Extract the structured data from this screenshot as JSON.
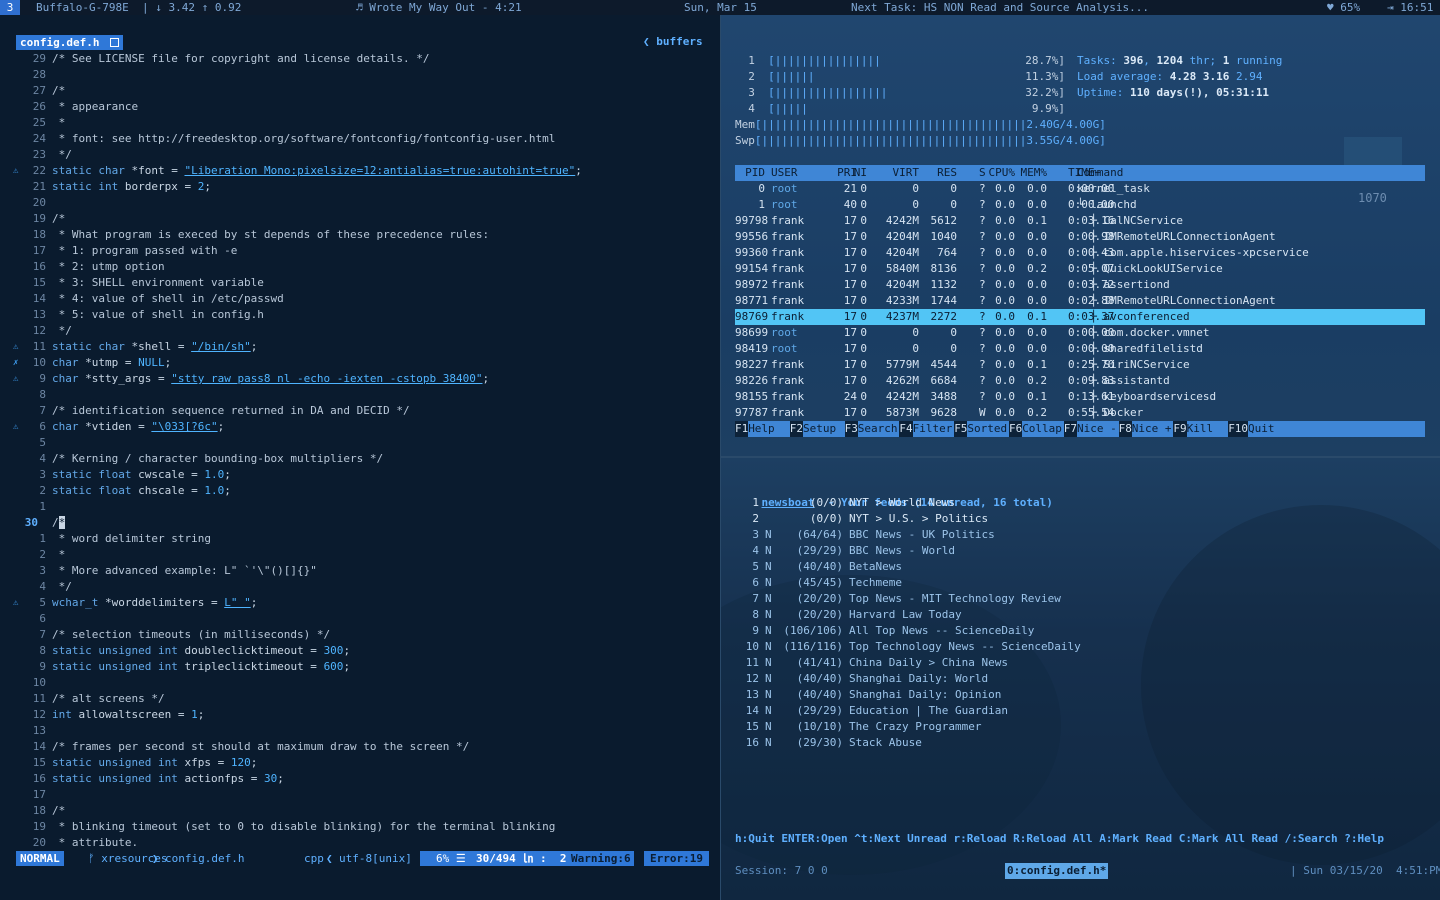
{
  "topbar": {
    "workspace": "3",
    "host": "Buffalo-G-798E",
    "net": "| ↓ 3.42 ↑ 0.92",
    "music": "♬ Wrote My Way Out - 4:21",
    "date": "Sun, Mar 15",
    "task": "Next Task: HS NON Read and Source Analysis...",
    "battery": "♥ 65%",
    "clock": "⇥ 16:51"
  },
  "editor": {
    "tab": "config.def.h",
    "tab_icon": "save-icon",
    "buffers_label": "buffers",
    "lines": [
      {
        "n": "29",
        "t": "/* See LICENSE file for copyright and license details. */"
      },
      {
        "n": "28",
        "t": ""
      },
      {
        "n": "27",
        "t": "/*"
      },
      {
        "n": "26",
        "t": " * appearance"
      },
      {
        "n": "25",
        "t": " *"
      },
      {
        "n": "24",
        "t": " * font: see http://freedesktop.org/software/fontconfig/fontconfig-user.html"
      },
      {
        "n": "23",
        "t": " */"
      },
      {
        "n": "22",
        "s": "⚠",
        "t": "static char *font = \"Liberation Mono:pixelsize=12:antialias=true:autohint=true\";"
      },
      {
        "n": "21",
        "t": "static int borderpx = 2;"
      },
      {
        "n": "20",
        "t": ""
      },
      {
        "n": "19",
        "t": "/*"
      },
      {
        "n": "18",
        "t": " * What program is execed by st depends of these precedence rules:"
      },
      {
        "n": "17",
        "t": " * 1: program passed with -e"
      },
      {
        "n": "16",
        "t": " * 2: utmp option"
      },
      {
        "n": "15",
        "t": " * 3: SHELL environment variable"
      },
      {
        "n": "14",
        "t": " * 4: value of shell in /etc/passwd"
      },
      {
        "n": "13",
        "t": " * 5: value of shell in config.h"
      },
      {
        "n": "12",
        "t": " */"
      },
      {
        "n": "11",
        "s": "⚠",
        "t": "static char *shell = \"/bin/sh\";"
      },
      {
        "n": "10",
        "s": "✗",
        "t": "char *utmp = NULL;"
      },
      {
        "n": "9",
        "s": "⚠",
        "t": "char *stty_args = \"stty raw pass8 nl -echo -iexten -cstopb 38400\";"
      },
      {
        "n": "8",
        "t": ""
      },
      {
        "n": "7",
        "t": "/* identification sequence returned in DA and DECID */"
      },
      {
        "n": "6",
        "s": "⚠",
        "t": "char *vtiden = \"\\033[?6c\";"
      },
      {
        "n": "5",
        "t": ""
      },
      {
        "n": "4",
        "t": "/* Kerning / character bounding-box multipliers */"
      },
      {
        "n": "3",
        "t": "static float cwscale = 1.0;"
      },
      {
        "n": "2",
        "t": "static float chscale = 1.0;"
      },
      {
        "n": "1",
        "t": ""
      },
      {
        "n": "30",
        "cur": true,
        "t": "/*"
      },
      {
        "n": "1",
        "t": " * word delimiter string"
      },
      {
        "n": "2",
        "t": " *"
      },
      {
        "n": "3",
        "t": " * More advanced example: L\" `'\\\"()[]{}\""
      },
      {
        "n": "4",
        "t": " */"
      },
      {
        "n": "5",
        "s": "⚠",
        "t": "wchar_t *worddelimiters = L\" \";"
      },
      {
        "n": "6",
        "t": ""
      },
      {
        "n": "7",
        "t": "/* selection timeouts (in milliseconds) */"
      },
      {
        "n": "8",
        "t": "static unsigned int doubleclicktimeout = 300;"
      },
      {
        "n": "9",
        "t": "static unsigned int tripleclicktimeout = 600;"
      },
      {
        "n": "10",
        "t": ""
      },
      {
        "n": "11",
        "t": "/* alt screens */"
      },
      {
        "n": "12",
        "t": "int allowaltscreen = 1;"
      },
      {
        "n": "13",
        "t": ""
      },
      {
        "n": "14",
        "t": "/* frames per second st should at maximum draw to the screen */"
      },
      {
        "n": "15",
        "t": "static unsigned int xfps = 120;"
      },
      {
        "n": "16",
        "t": "static unsigned int actionfps = 30;"
      },
      {
        "n": "17",
        "t": ""
      },
      {
        "n": "18",
        "t": "/*"
      },
      {
        "n": "19",
        "t": " * blinking timeout (set to 0 to disable blinking) for the terminal blinking"
      },
      {
        "n": "20",
        "t": " * attribute."
      }
    ],
    "status": {
      "mode": "NORMAL",
      "branch": "ᚠ xresources",
      "file": "config.def.h",
      "ft": "cpp",
      "enc": "utf-8[unix]",
      "pct": "6% ☰",
      "pos": "30/494 ㏑ :  2",
      "warn": "Warning:6",
      "err": "Error:19"
    }
  },
  "htop": {
    "cpus": [
      {
        "id": "1",
        "bar": "[||||||||||||||||",
        "pct": "28.7%]"
      },
      {
        "id": "2",
        "bar": "[||||||",
        "pct": "11.3%]"
      },
      {
        "id": "3",
        "bar": "[|||||||||||||||||",
        "pct": "32.2%]"
      },
      {
        "id": "4",
        "bar": "[|||||",
        "pct": "9.9%]"
      }
    ],
    "mem": {
      "label": "Mem",
      "bar": "[||||||||||||||||||||||||||||||||||||||||2.40G/4.00G]"
    },
    "swp": {
      "label": "Swp",
      "bar": "[||||||||||||||||||||||||||||||||||||||||3.55G/4.00G]"
    },
    "tasks": [
      "Tasks: ",
      "396",
      ", ",
      "1204",
      " thr; ",
      "1",
      " running"
    ],
    "load": [
      "Load average: ",
      "4.28",
      " ",
      "3.16",
      " 2.94"
    ],
    "uptime": [
      "Uptime: ",
      "110 days(!), 05:31:11"
    ],
    "headers": [
      "PID",
      "USER",
      "PRI",
      "NI",
      "VIRT",
      "RES",
      "S",
      "CPU%",
      "MEM%",
      "TIME+",
      "Command"
    ],
    "rows": [
      [
        "0",
        "root",
        "21",
        "0",
        "0",
        "0",
        "?",
        "0.0",
        "0.0",
        "0:00.00",
        "kernel_task"
      ],
      [
        "1",
        "root",
        "40",
        "0",
        "0",
        "0",
        "?",
        "0.0",
        "0.0",
        "0:00.00",
        "└ launchd"
      ],
      [
        "99798",
        "frank",
        "17",
        "0",
        "4242M",
        "5612",
        "?",
        "0.0",
        "0.1",
        "0:03.16",
        "  ├ CalNCService"
      ],
      [
        "99556",
        "frank",
        "17",
        "0",
        "4204M",
        "1040",
        "?",
        "0.0",
        "0.0",
        "0:00.98",
        "  ├ IMRemoteURLConnectionAgent"
      ],
      [
        "99360",
        "frank",
        "17",
        "0",
        "4204M",
        "764",
        "?",
        "0.0",
        "0.0",
        "0:00.43",
        "  ├ com.apple.hiservices-xpcservice"
      ],
      [
        "99154",
        "frank",
        "17",
        "0",
        "5840M",
        "8136",
        "?",
        "0.0",
        "0.2",
        "0:05.07",
        "  ├ QuickLookUIService"
      ],
      [
        "98972",
        "frank",
        "17",
        "0",
        "4204M",
        "1132",
        "?",
        "0.0",
        "0.0",
        "0:03.72",
        "  ├ assertiond"
      ],
      [
        "98771",
        "frank",
        "17",
        "0",
        "4233M",
        "1744",
        "?",
        "0.0",
        "0.0",
        "0:02.88",
        "  ├ IMRemoteURLConnectionAgent"
      ],
      [
        "98769",
        "frank",
        "17",
        "0",
        "4237M",
        "2272",
        "?",
        "0.0",
        "0.1",
        "0:03.37",
        "  ├ avconferenced"
      ],
      [
        "98699",
        "root",
        "17",
        "0",
        "0",
        "0",
        "?",
        "0.0",
        "0.0",
        "0:00.00",
        "  ├ com.docker.vmnet"
      ],
      [
        "98419",
        "root",
        "17",
        "0",
        "0",
        "0",
        "?",
        "0.0",
        "0.0",
        "0:00.00",
        "  ├ sharedfilelistd"
      ],
      [
        "98227",
        "frank",
        "17",
        "0",
        "5779M",
        "4544",
        "?",
        "0.0",
        "0.1",
        "0:25.70",
        "  ├ SiriNCService"
      ],
      [
        "98226",
        "frank",
        "17",
        "0",
        "4262M",
        "6684",
        "?",
        "0.0",
        "0.2",
        "0:09.83",
        "  ├ assistantd"
      ],
      [
        "98155",
        "frank",
        "24",
        "0",
        "4242M",
        "3488",
        "?",
        "0.0",
        "0.1",
        "0:13.61",
        "  ├ keyboardservicesd"
      ],
      [
        "97787",
        "frank",
        "17",
        "0",
        "5873M",
        "9628",
        "W",
        "0.0",
        "0.2",
        "0:55.54",
        "  ├ Docker"
      ]
    ],
    "selected_row": 8,
    "fkeys": [
      {
        "k": "F1",
        "l": "Help"
      },
      {
        "k": "F2",
        "l": "Setup"
      },
      {
        "k": "F3",
        "l": "Search"
      },
      {
        "k": "F4",
        "l": "Filter"
      },
      {
        "k": "F5",
        "l": "Sorted"
      },
      {
        "k": "F6",
        "l": "Collap"
      },
      {
        "k": "F7",
        "l": "Nice -"
      },
      {
        "k": "F8",
        "l": "Nice +"
      },
      {
        "k": "F9",
        "l": "Kill"
      },
      {
        "k": "F10",
        "l": "Quit"
      }
    ],
    "bg_number": "1070"
  },
  "newsboat": {
    "title": "newsboat",
    "subtitle": "- Your feeds (14 unread, 16 total)",
    "feeds": [
      {
        "i": "1",
        "f": "",
        "c": "(0/0)",
        "t": "NYT > World News"
      },
      {
        "i": "2",
        "f": "",
        "c": "(0/0)",
        "t": "NYT > U.S. > Politics"
      },
      {
        "i": "3",
        "f": "N",
        "c": "(64/64)",
        "t": "BBC News - UK Politics"
      },
      {
        "i": "4",
        "f": "N",
        "c": "(29/29)",
        "t": "BBC News - World"
      },
      {
        "i": "5",
        "f": "N",
        "c": "(40/40)",
        "t": "BetaNews"
      },
      {
        "i": "6",
        "f": "N",
        "c": "(45/45)",
        "t": "Techmeme"
      },
      {
        "i": "7",
        "f": "N",
        "c": "(20/20)",
        "t": "Top News - MIT Technology Review"
      },
      {
        "i": "8",
        "f": "N",
        "c": "(20/20)",
        "t": "Harvard Law Today"
      },
      {
        "i": "9",
        "f": "N",
        "c": "(106/106)",
        "t": "All Top News -- ScienceDaily"
      },
      {
        "i": "10",
        "f": "N",
        "c": "(116/116)",
        "t": "Top Technology News -- ScienceDaily"
      },
      {
        "i": "11",
        "f": "N",
        "c": "(41/41)",
        "t": "China Daily > China News"
      },
      {
        "i": "12",
        "f": "N",
        "c": "(40/40)",
        "t": "Shanghai Daily: World"
      },
      {
        "i": "13",
        "f": "N",
        "c": "(40/40)",
        "t": "Shanghai Daily: Opinion"
      },
      {
        "i": "14",
        "f": "N",
        "c": "(29/29)",
        "t": "Education | The Guardian"
      },
      {
        "i": "15",
        "f": "N",
        "c": "(10/10)",
        "t": "The Crazy Programmer"
      },
      {
        "i": "16",
        "f": "N",
        "c": "(29/30)",
        "t": "Stack Abuse"
      }
    ],
    "help": "h:Quit ENTER:Open ^t:Next Unread r:Reload R:Reload All A:Mark Read C:Mark All Read /:Search ?:Help"
  },
  "tmux": {
    "session": "Session: 7 0 0",
    "window": "0:config.def.h*",
    "right": "| Sun 03/15/20  4:51:PM"
  },
  "colors": {
    "accent": "#2f78d8",
    "highlight": "#52c5f5",
    "bg": "#0a1b2e"
  }
}
